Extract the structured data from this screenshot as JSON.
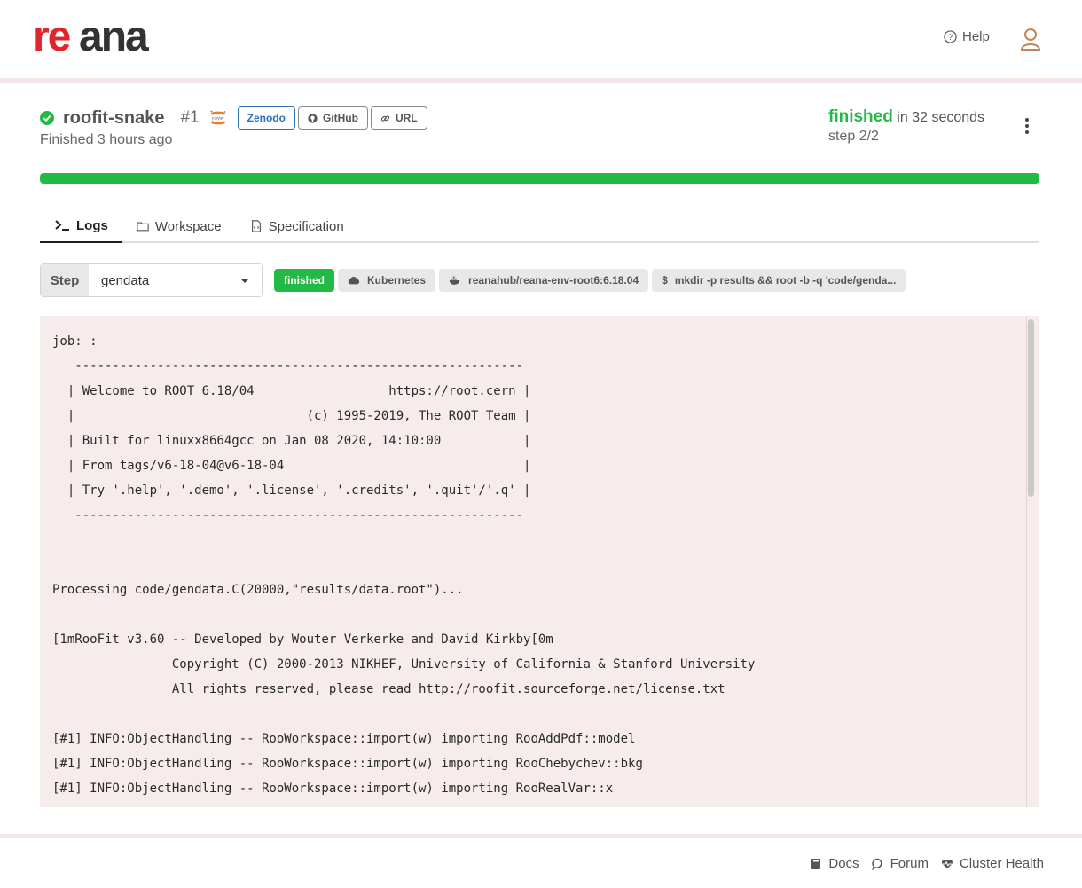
{
  "brand": {
    "logo_text": "reana",
    "accent": "#e0262c",
    "logo_dark": "#333333"
  },
  "header": {
    "help_label": "Help",
    "help_icon": "question-circle-icon",
    "user_icon": "user-icon"
  },
  "workflow": {
    "name": "roofit-snake",
    "run": "#1",
    "status_icon": "check-circle-icon",
    "subtitle": "Finished 3 hours ago",
    "links": {
      "zenodo": "Zenodo",
      "github": "GitHub",
      "url": "URL"
    },
    "status": "finished",
    "duration": "in 32 seconds",
    "step": "step 2/2",
    "progress": 1.0,
    "status_color": "#21ba45"
  },
  "tabs": [
    {
      "label": "Logs",
      "icon": "terminal-icon"
    },
    {
      "label": "Workspace",
      "icon": "folder-icon"
    },
    {
      "label": "Specification",
      "icon": "file-code-icon"
    }
  ],
  "step_selector": {
    "label": "Step",
    "value": "gendata"
  },
  "job_labels": {
    "status": "finished",
    "backend": "Kubernetes",
    "image": "reanahub/reana-env-root6:6.18.04",
    "command": "mkdir -p results && root -b -q 'code/genda..."
  },
  "log_lines": [
    "job: :",
    "   ------------------------------------------------------------",
    "  | Welcome to ROOT 6.18/04                  https://root.cern |",
    "  |                               (c) 1995-2019, The ROOT Team |",
    "  | Built for linuxx8664gcc on Jan 08 2020, 14:10:00           |",
    "  | From tags/v6-18-04@v6-18-04                                |",
    "  | Try '.help', '.demo', '.license', '.credits', '.quit'/'.q' |",
    "   ------------------------------------------------------------",
    "",
    "",
    "Processing code/gendata.C(20000,\"results/data.root\")...",
    "",
    "[1mRooFit v3.60 -- Developed by Wouter Verkerke and David Kirkby[0m",
    "                Copyright (C) 2000-2013 NIKHEF, University of California & Stanford University",
    "                All rights reserved, please read http://roofit.sourceforge.net/license.txt",
    "",
    "[#1] INFO:ObjectHandling -- RooWorkspace::import(w) importing RooAddPdf::model",
    "[#1] INFO:ObjectHandling -- RooWorkspace::import(w) importing RooChebychev::bkg",
    "[#1] INFO:ObjectHandling -- RooWorkspace::import(w) importing RooRealVar::x"
  ],
  "footer": {
    "docs": "Docs",
    "forum": "Forum",
    "health": "Cluster Health"
  }
}
